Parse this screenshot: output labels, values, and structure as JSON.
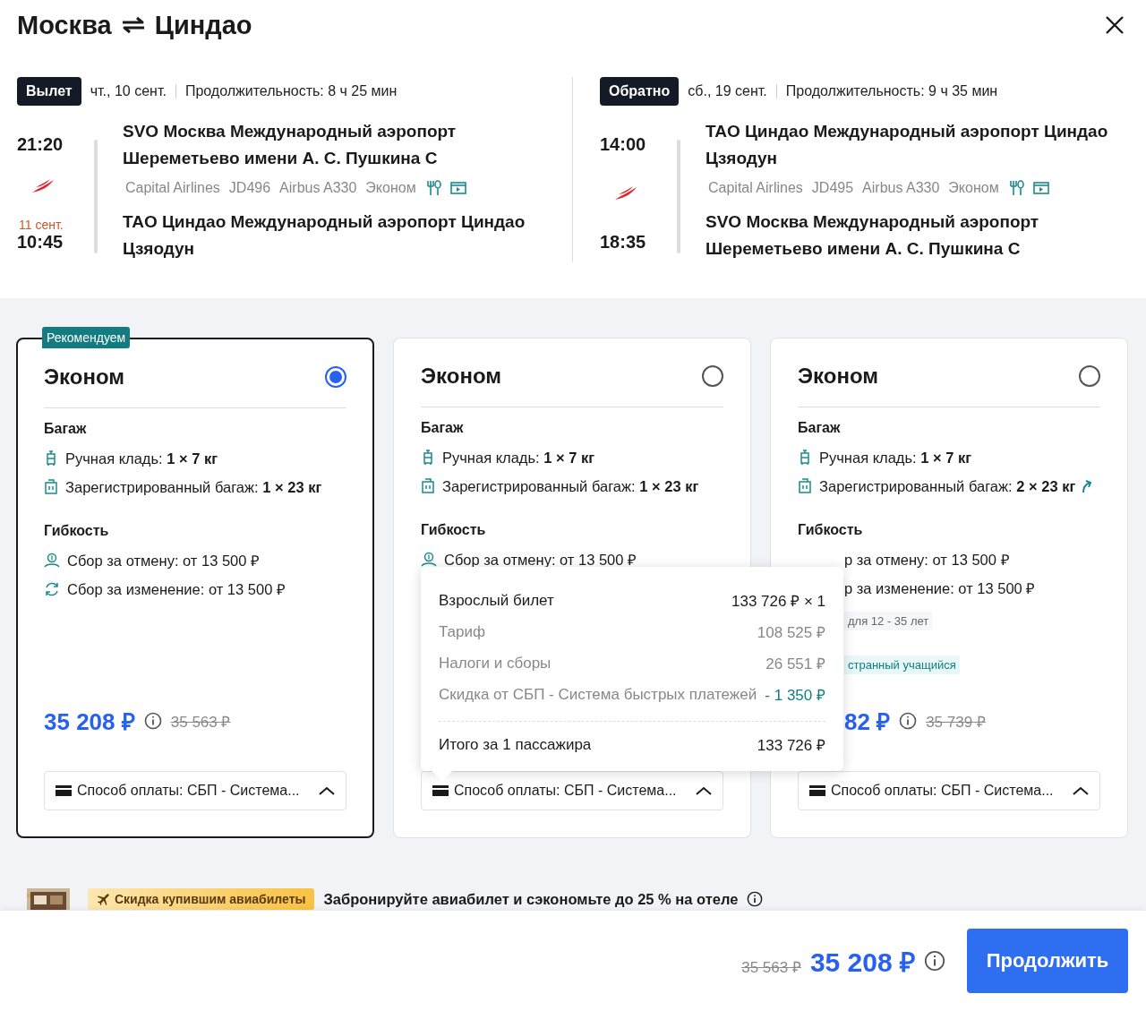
{
  "header": {
    "origin": "Москва",
    "destination": "Циндао"
  },
  "legs": [
    {
      "badge": "Вылет",
      "date": "чт., 10 сент.",
      "duration": "Продолжительность: 8 ч 25 мин",
      "departure_time": "21:20",
      "arrival_date": "11 сент.",
      "arrival_time": "10:45",
      "from": "SVO Москва Международный аэропорт Шереметьево имени А. С. Пушкина C",
      "to": "TAO Циндао Международный аэропорт Циндао Цзяодун",
      "details": [
        "Capital Airlines",
        "JD496",
        "Airbus A330",
        "Эконом"
      ]
    },
    {
      "badge": "Обратно",
      "date": "сб., 19 сент.",
      "duration": "Продолжительность: 9 ч 35 мин",
      "departure_time": "14:00",
      "arrival_time": "18:35",
      "from": "TAO Циндао Международный аэропорт Циндао Цзяодун",
      "to": "SVO Москва Международный аэропорт Шереметьево имени А. С. Пушкина C",
      "details": [
        "Capital Airlines",
        "JD495",
        "Airbus A330",
        "Эконом"
      ]
    }
  ],
  "fares": [
    {
      "kind": "full",
      "badge": "Рекомендуем",
      "title": "Эконом",
      "selected": true,
      "baggage_heading": "Багаж",
      "baggage": [
        {
          "kind": "hand",
          "text": "Ручная кладь: **1 × 7 кг**",
          "upgrade": false
        },
        {
          "kind": "checked",
          "text": "Зарегистрированный багаж: **1 × 23 кг**",
          "upgrade": false
        }
      ],
      "flexibility_heading": "Гибкость",
      "flexibility": [
        {
          "kind": "cancel",
          "text": "Сбор за отмену: от 13 500 ₽"
        },
        {
          "kind": "change",
          "text": "Сбор за изменение: от 13 500 ₽"
        }
      ],
      "price": "35 208 ₽",
      "old_price": "35 563 ₽",
      "payment": "Способ оплаты: СБП - Система..."
    },
    {
      "kind": "full",
      "title": "Эконом",
      "selected": false,
      "baggage_heading": "Багаж",
      "baggage": [
        {
          "kind": "hand",
          "text": "Ручная кладь: **1 × 7 кг**",
          "upgrade": false
        },
        {
          "kind": "checked",
          "text": "Зарегистрированный багаж: **1 × 23 кг**",
          "upgrade": false
        }
      ],
      "flexibility_heading": "Гибкость",
      "flexibility": [
        {
          "kind": "cancel",
          "text": "Сбор за отмену: от 13 500 ₽"
        }
      ],
      "payment": "Способ оплаты: СБП - Система..."
    },
    {
      "kind": "covered",
      "title": "Эконом",
      "selected": false,
      "baggage_heading": "Багаж",
      "baggage": [
        {
          "kind": "hand",
          "text": "Ручная кладь: **1 × 7 кг**",
          "upgrade": false
        },
        {
          "kind": "checked",
          "text": "Зарегистрированный багаж: **2 × 23 кг**",
          "upgrade": true
        }
      ],
      "flexibility_heading": "Гибкость",
      "flexibility": [
        {
          "kind": "clipped",
          "text": "р за отмену: от 13 500 ₽"
        },
        {
          "kind": "clipped",
          "text": "р за изменение: от 13 500 ₽"
        }
      ],
      "tags": [
        {
          "kind": "age",
          "text": "для 12 - 35 лет"
        },
        {
          "kind": "student",
          "text": "странный учащийся"
        }
      ],
      "price": "82 ₽",
      "old_price": "35 739 ₽",
      "payment": "Способ оплаты: СБП - Система..."
    }
  ],
  "price_popover": {
    "rows": [
      {
        "kind": "main",
        "label": "Взрослый билет",
        "value": "133 726 ₽ × 1"
      },
      {
        "kind": "sub",
        "label": "Тариф",
        "value": "108 525 ₽"
      },
      {
        "kind": "sub",
        "label": "Налоги и сборы",
        "value": "26 551 ₽"
      },
      {
        "kind": "discount",
        "label": "Скидка от СБП - Система быстрых платежей",
        "value": "- 1 350 ₽"
      }
    ],
    "total": {
      "label": "Итого за 1 пассажира",
      "value": "133 726 ₽"
    }
  },
  "promo": {
    "badge": "Скидка купившим авиабилеты",
    "text": "Забронируйте авиабилет и сэкономьте до 25 % на отеле"
  },
  "footer": {
    "old_price": "35 563 ₽",
    "price": "35 208 ₽",
    "button": "Продолжить"
  }
}
